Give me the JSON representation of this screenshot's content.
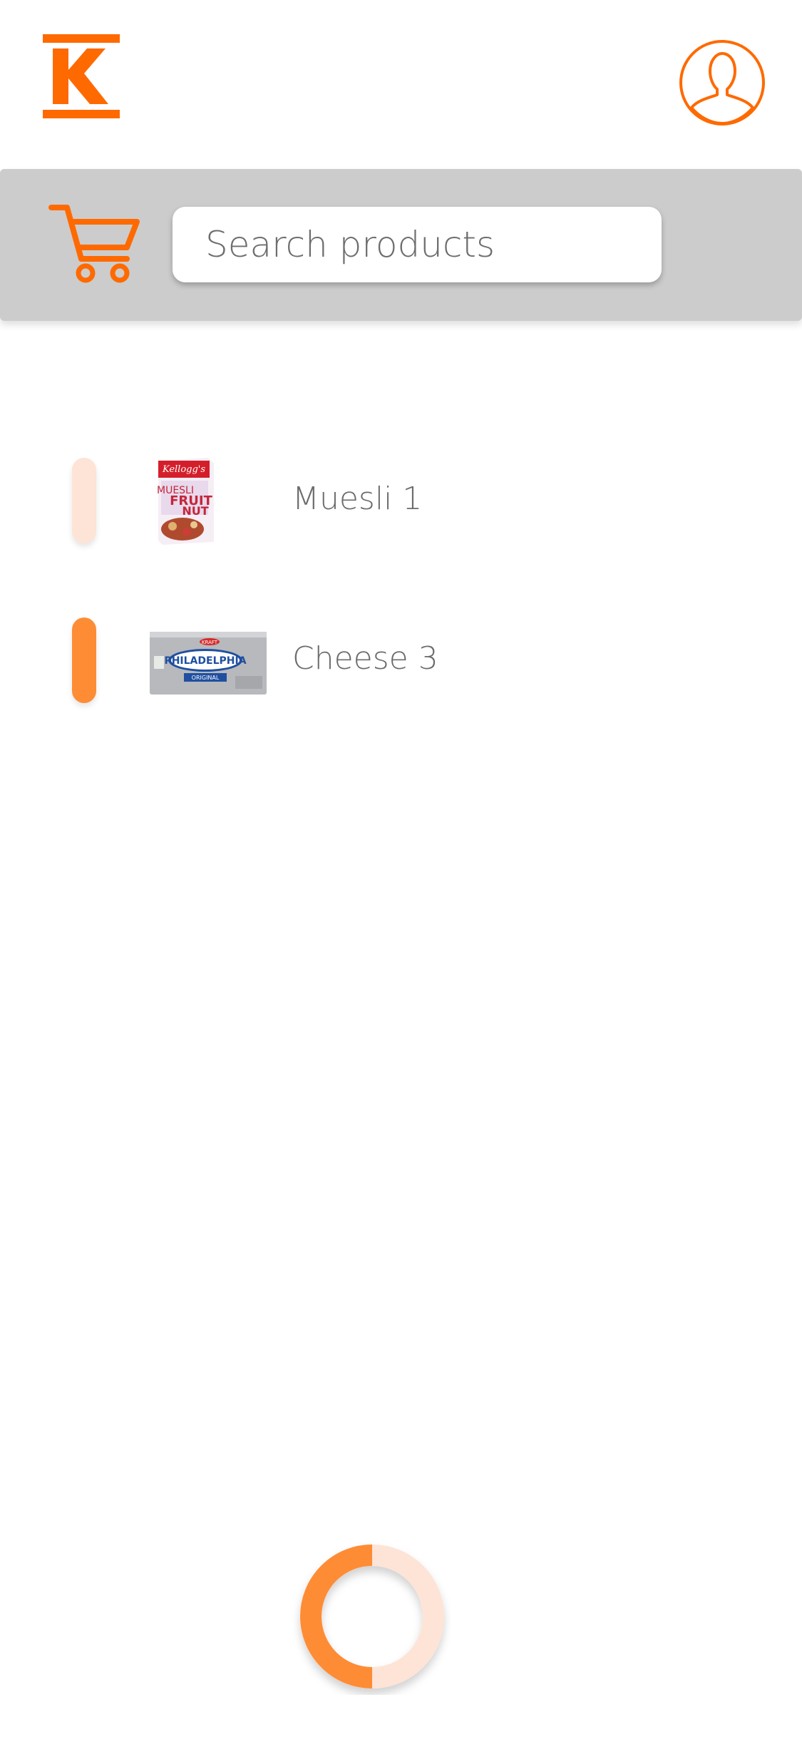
{
  "colors": {
    "brand_orange": "#fe6a00",
    "accent_orange": "#fe8c34",
    "light_peach": "#fde4d6",
    "search_bar_bg": "#cccccc",
    "text_gray": "#6b6b6b"
  },
  "header": {
    "logo_icon": "k-logo-icon",
    "profile_icon": "user-profile-icon"
  },
  "search": {
    "cart_icon": "shopping-cart-icon",
    "placeholder": "Search products"
  },
  "items": [
    {
      "label": "Muesli 1",
      "status": "unselected",
      "thumb_text": "MUESLI FRUIT NUT",
      "brand": "Kellogg's"
    },
    {
      "label": "Cheese 3",
      "status": "selected",
      "thumb_text": "PHILADELPHIA",
      "sub": "ORIGINAL",
      "brand": "KRAFT"
    }
  ],
  "progress": {
    "value": 0.5,
    "icon": "progress-ring"
  }
}
